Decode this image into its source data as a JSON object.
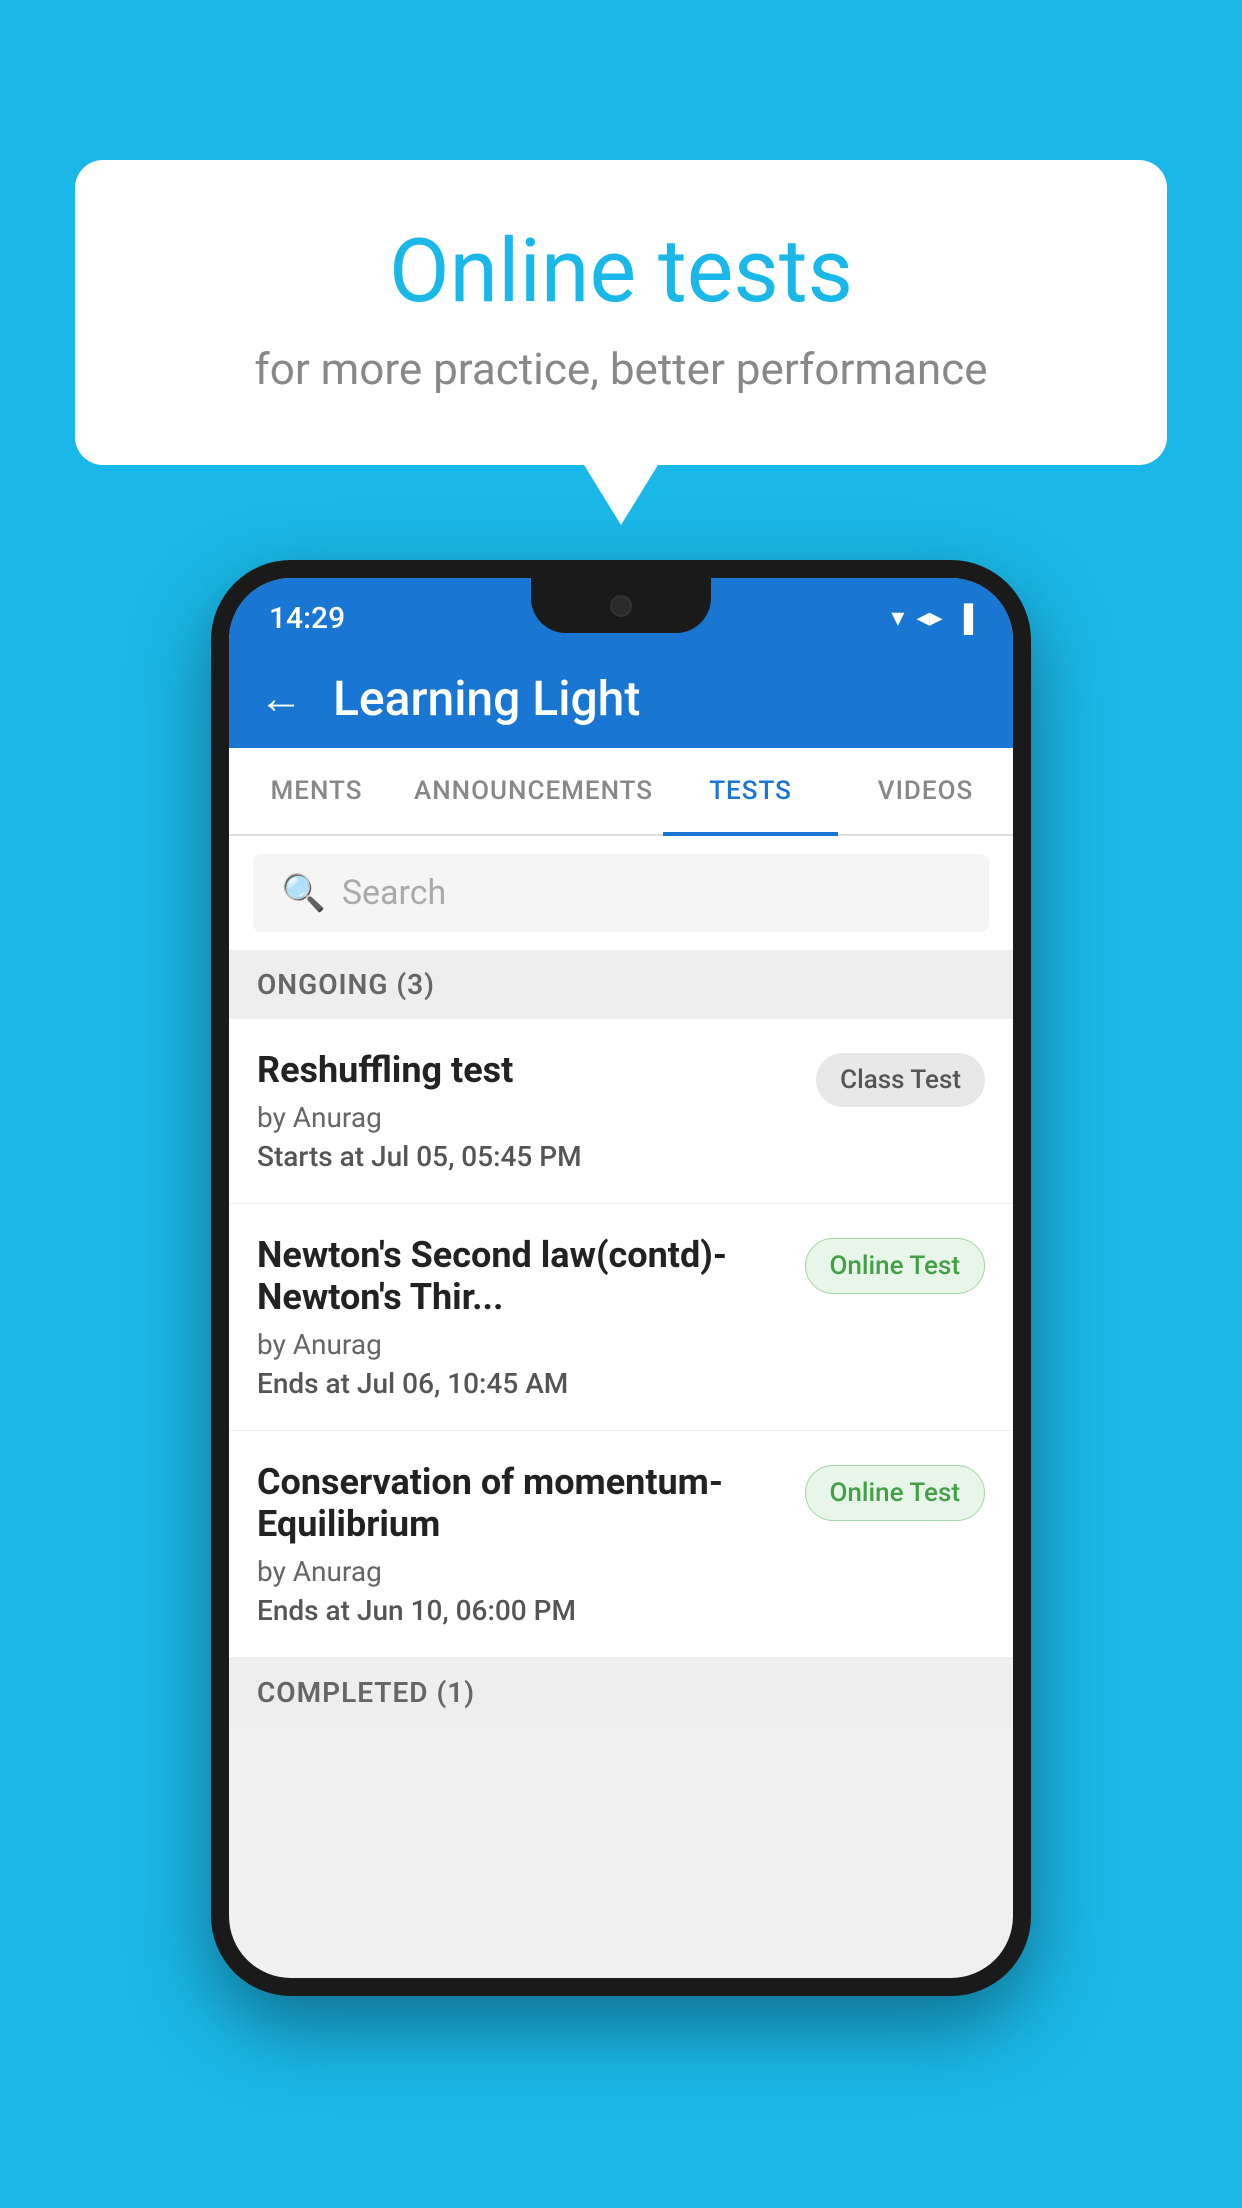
{
  "background": {
    "color": "#1ab8e8"
  },
  "speechBubble": {
    "title": "Online tests",
    "subtitle": "for more practice, better performance"
  },
  "phone": {
    "statusBar": {
      "time": "14:29",
      "icons": [
        "▼",
        "▲",
        "▌"
      ]
    },
    "appBar": {
      "backLabel": "←",
      "title": "Learning Light"
    },
    "tabs": [
      {
        "label": "MENTS",
        "active": false
      },
      {
        "label": "ANNOUNCEMENTS",
        "active": false
      },
      {
        "label": "TESTS",
        "active": true
      },
      {
        "label": "VIDEOS",
        "active": false
      }
    ],
    "search": {
      "placeholder": "Search"
    },
    "sections": [
      {
        "header": "ONGOING (3)",
        "items": [
          {
            "name": "Reshuffling test",
            "author": "by Anurag",
            "timeLabel": "Starts at",
            "timeValue": "Jul 05, 05:45 PM",
            "badgeText": "Class Test",
            "badgeType": "class"
          },
          {
            "name": "Newton's Second law(contd)-Newton's Thir...",
            "author": "by Anurag",
            "timeLabel": "Ends at",
            "timeValue": "Jul 06, 10:45 AM",
            "badgeText": "Online Test",
            "badgeType": "online"
          },
          {
            "name": "Conservation of momentum-Equilibrium",
            "author": "by Anurag",
            "timeLabel": "Ends at",
            "timeValue": "Jun 10, 06:00 PM",
            "badgeText": "Online Test",
            "badgeType": "online"
          }
        ]
      },
      {
        "header": "COMPLETED (1)",
        "items": []
      }
    ]
  }
}
